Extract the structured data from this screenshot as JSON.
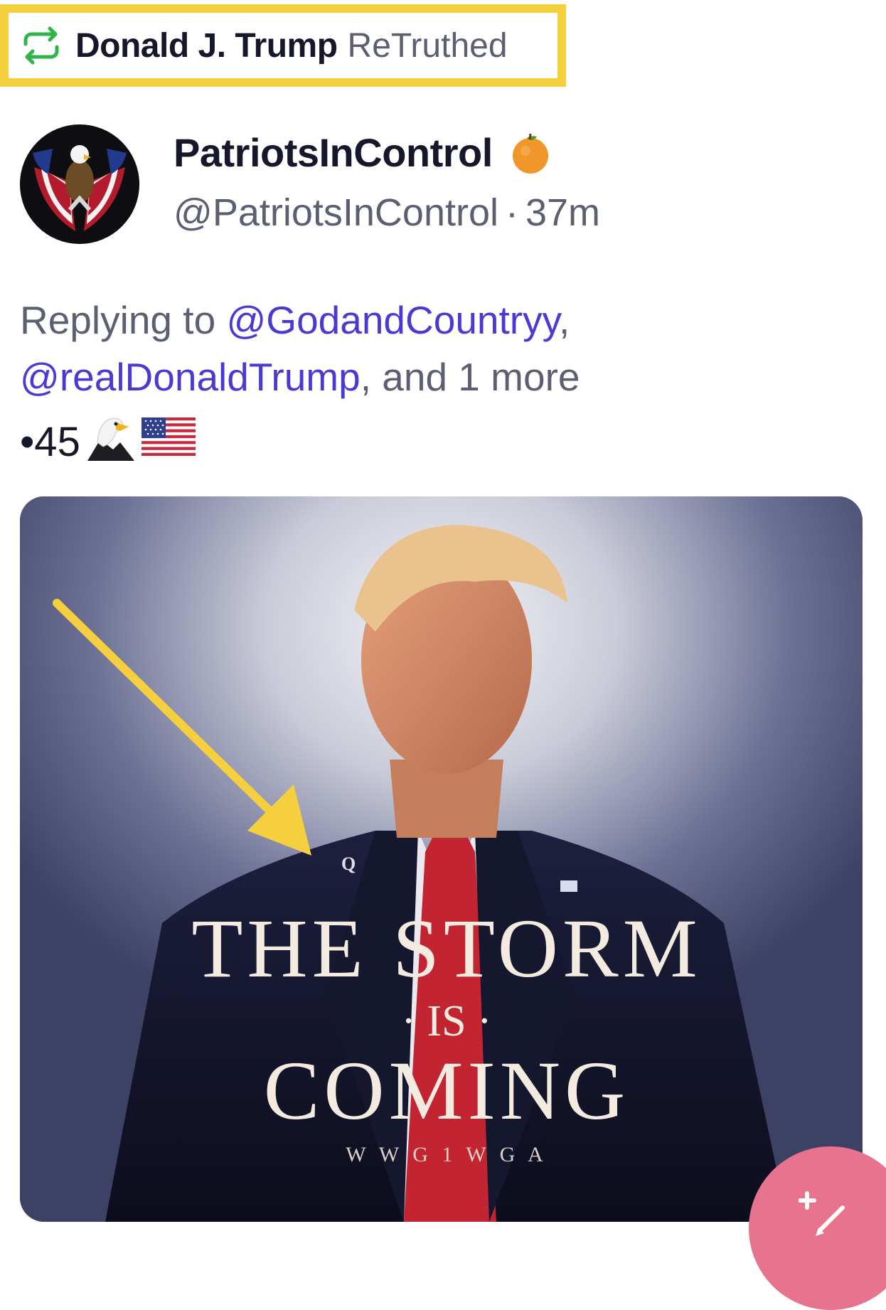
{
  "retruth": {
    "user": "Donald J. Trump",
    "action": "ReTruthed",
    "icon": "retruth-icon",
    "highlight_color": "#f6cf3f"
  },
  "post": {
    "author_name": "PatriotsInControl",
    "badge_icon": "orange-badge-icon",
    "handle": "@PatriotsInControl",
    "separator": "·",
    "time": "37m",
    "reply_prefix": "Replying to",
    "mention_1": "@GodandCountryy",
    "comma": ",",
    "mention_2": "@realDonaldTrump",
    "reply_suffix": ", and 1 more",
    "body": "•45",
    "body_emoji_1": "🦅",
    "body_emoji_2": "🇺🇸"
  },
  "media": {
    "line_1": "THE STORM",
    "line_2": "· IS ·",
    "line_3": "COMING",
    "line_4": "W W G 1 W G A",
    "lapel_letter": "Q",
    "arrow_color": "#f6cf3f"
  },
  "fab": {
    "icon": "compose-icon",
    "color": "#e8738f"
  }
}
